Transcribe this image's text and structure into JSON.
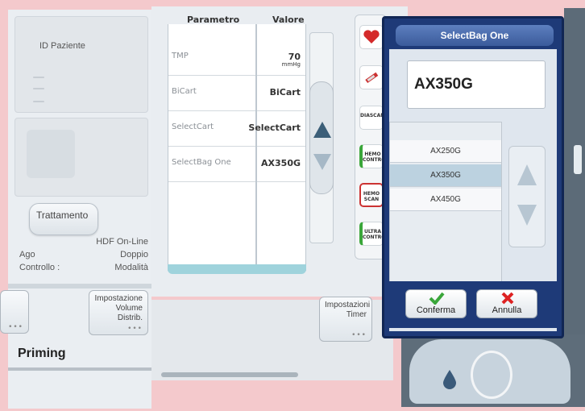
{
  "patient": {
    "id_label": "ID Paziente"
  },
  "treatment": {
    "button_label": "Trattamento",
    "mode": "HDF On-Line",
    "needle_label": "Ago",
    "needle_value": "Doppio",
    "control_label": "Controllo :",
    "mode_label": "Modalità"
  },
  "table": {
    "header_param": "Parametro",
    "header_value": "Valore",
    "rows": [
      {
        "param": "TMP",
        "value": "70",
        "unit": "mmHg"
      },
      {
        "param": "BiCart",
        "value": "BiCart",
        "unit": ""
      },
      {
        "param": "SelectCart",
        "value": "SelectCart",
        "unit": ""
      },
      {
        "param": "SelectBag One",
        "value": "AX350G",
        "unit": ""
      }
    ]
  },
  "icons": [
    {
      "name": "heart-icon",
      "text": ""
    },
    {
      "name": "syringe-icon",
      "text": ""
    },
    {
      "name": "diascan-icon",
      "text": "DIASCAN"
    },
    {
      "name": "hemocontrol-icon",
      "text": "HEMO CONTROL"
    },
    {
      "name": "hemoscan-icon",
      "text": "HEMO SCAN"
    },
    {
      "name": "ultracontrol-icon",
      "text": "ULTRA CONTROL"
    }
  ],
  "dialog": {
    "title": "SelectBag One",
    "current_value": "AX350G",
    "options": [
      "AX250G",
      "AX350G",
      "AX450G"
    ],
    "selected_index": 1,
    "confirm_label": "Conferma",
    "cancel_label": "Annulla"
  },
  "bottom": {
    "btn_distribution": "Impostazione Volume Distrib.",
    "btn_timer": "Impostazioni Timer",
    "status": "Priming"
  },
  "colors": {
    "dialog_bg": "#1e3a78",
    "accent": "#4a6fb0",
    "selected_row": "#bcd2e0",
    "confirm_check": "#3aa63a",
    "cancel_x": "#d22"
  }
}
